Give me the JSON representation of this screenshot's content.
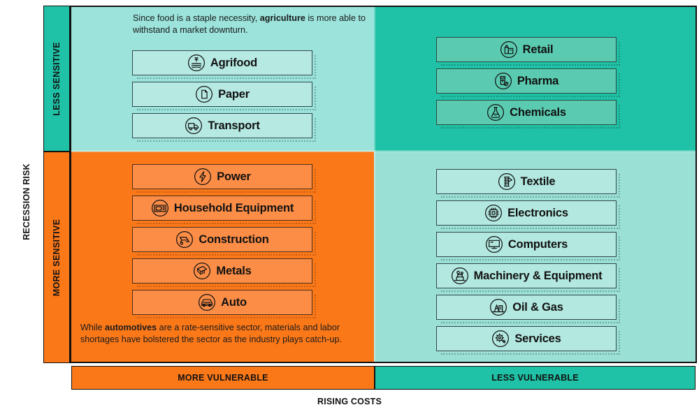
{
  "axes": {
    "y_title": "RECESSION RISK",
    "x_title": "RISING COSTS",
    "y_bands": [
      {
        "label": "LESS SENSITIVE",
        "color": "#1FC2A6"
      },
      {
        "label": "MORE SENSITIVE",
        "color": "#FB7819"
      }
    ],
    "x_bands": [
      {
        "label": "MORE VULNERABLE",
        "color": "#FB7819"
      },
      {
        "label": "LESS VULNERABLE",
        "color": "#1FC2A6"
      }
    ]
  },
  "notes": {
    "top_left": {
      "part1": "Since food is a staple necessity, ",
      "bold": "agriculture",
      "part2": " is more able to withstand a market downturn."
    },
    "bottom_left": {
      "part1": "While ",
      "bold": "automotives",
      "part2": " are a rate-sensitive sector, materials and labor shortages have bolstered the sector as the industry plays catch-up."
    }
  },
  "quadrants": {
    "top_left": {
      "name": "less-sensitive-more-vulnerable",
      "background": "#9BE3DB",
      "item_fill": "#B6E9E2",
      "items": [
        {
          "label": "Agrifood",
          "icon": "wheat-field-icon"
        },
        {
          "label": "Paper",
          "icon": "paper-sheet-icon"
        },
        {
          "label": "Transport",
          "icon": "delivery-truck-icon"
        }
      ]
    },
    "top_right": {
      "name": "less-sensitive-less-vulnerable",
      "background": "#1FC2A6",
      "item_fill": "#5ACBB0",
      "items": [
        {
          "label": "Retail",
          "icon": "shopping-bags-icon"
        },
        {
          "label": "Pharma",
          "icon": "pill-bottle-icon"
        },
        {
          "label": "Chemicals",
          "icon": "flask-icon"
        }
      ]
    },
    "bottom_left": {
      "name": "more-sensitive-more-vulnerable",
      "background": "#FB7819",
      "item_fill": "#FC8D47",
      "items": [
        {
          "label": "Power",
          "icon": "lightning-bolt-icon"
        },
        {
          "label": "Household Equipment",
          "icon": "microwave-icon"
        },
        {
          "label": "Construction",
          "icon": "wheelbarrow-icon"
        },
        {
          "label": "Metals",
          "icon": "metal-sheet-icon"
        },
        {
          "label": "Auto",
          "icon": "car-icon"
        }
      ]
    },
    "bottom_right": {
      "name": "more-sensitive-less-vulnerable",
      "background": "#9BE0D5",
      "item_fill": "#B2E8E0",
      "items": [
        {
          "label": "Textile",
          "icon": "thread-spool-icon"
        },
        {
          "label": "Electronics",
          "icon": "microchip-icon"
        },
        {
          "label": "Computers",
          "icon": "monitor-icon"
        },
        {
          "label": "Machinery & Equipment",
          "icon": "factory-machine-icon"
        },
        {
          "label": "Oil & Gas",
          "icon": "oil-pump-icon"
        },
        {
          "label": "Services",
          "icon": "gear-wrench-icon"
        }
      ]
    }
  },
  "chart_data": {
    "type": "table",
    "title": "Sector sensitivity matrix",
    "xlabel": "RISING COSTS",
    "ylabel": "RECESSION RISK",
    "x_categories": [
      "MORE VULNERABLE",
      "LESS VULNERABLE"
    ],
    "y_categories": [
      "LESS SENSITIVE",
      "MORE SENSITIVE"
    ],
    "cells": [
      {
        "y": "LESS SENSITIVE",
        "x": "MORE VULNERABLE",
        "items": [
          "Agrifood",
          "Paper",
          "Transport"
        ]
      },
      {
        "y": "LESS SENSITIVE",
        "x": "LESS VULNERABLE",
        "items": [
          "Retail",
          "Pharma",
          "Chemicals"
        ]
      },
      {
        "y": "MORE SENSITIVE",
        "x": "MORE VULNERABLE",
        "items": [
          "Power",
          "Household Equipment",
          "Construction",
          "Metals",
          "Auto"
        ]
      },
      {
        "y": "MORE SENSITIVE",
        "x": "LESS VULNERABLE",
        "items": [
          "Textile",
          "Electronics",
          "Computers",
          "Machinery & Equipment",
          "Oil & Gas",
          "Services"
        ]
      }
    ]
  }
}
